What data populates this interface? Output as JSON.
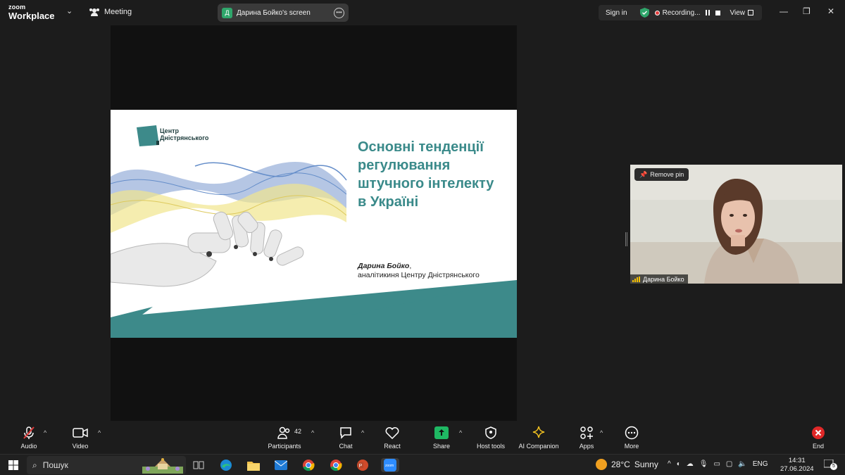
{
  "topbar": {
    "brand_line1": "zoom",
    "brand_line2": "Workplace",
    "meeting_label": "Meeting",
    "screen_avatar": "Д",
    "screen_label": "Дарина Бойко's screen",
    "signin_label": "Sign in",
    "recording_label": "Recording...",
    "view_label": "View"
  },
  "slide": {
    "logo_text": "Центр Дністрянського",
    "title": "Основні тенденції регулювання штучного інтелекту в Україні",
    "author_name": "Дарина Бойко",
    "author_role": "аналітикиня Центру Дністрянського",
    "colors": {
      "teal": "#3a8a8a",
      "blue": "#4a7ac0",
      "yellow": "#e8c840"
    }
  },
  "tile": {
    "pin_label": "Remove pin",
    "participant_name": "Дарина Бойко"
  },
  "toolbar": {
    "audio": "Audio",
    "video": "Video",
    "participants": "Participants",
    "participants_count": "42",
    "chat": "Chat",
    "react": "React",
    "share": "Share",
    "host_tools": "Host tools",
    "ai_companion": "AI Companion",
    "apps": "Apps",
    "more": "More",
    "end": "End"
  },
  "taskbar": {
    "search_placeholder": "Пошук",
    "temperature": "28°C",
    "weather": "Sunny",
    "language": "ENG",
    "time": "14:31",
    "date": "27.06.2024",
    "notifications": "5"
  }
}
